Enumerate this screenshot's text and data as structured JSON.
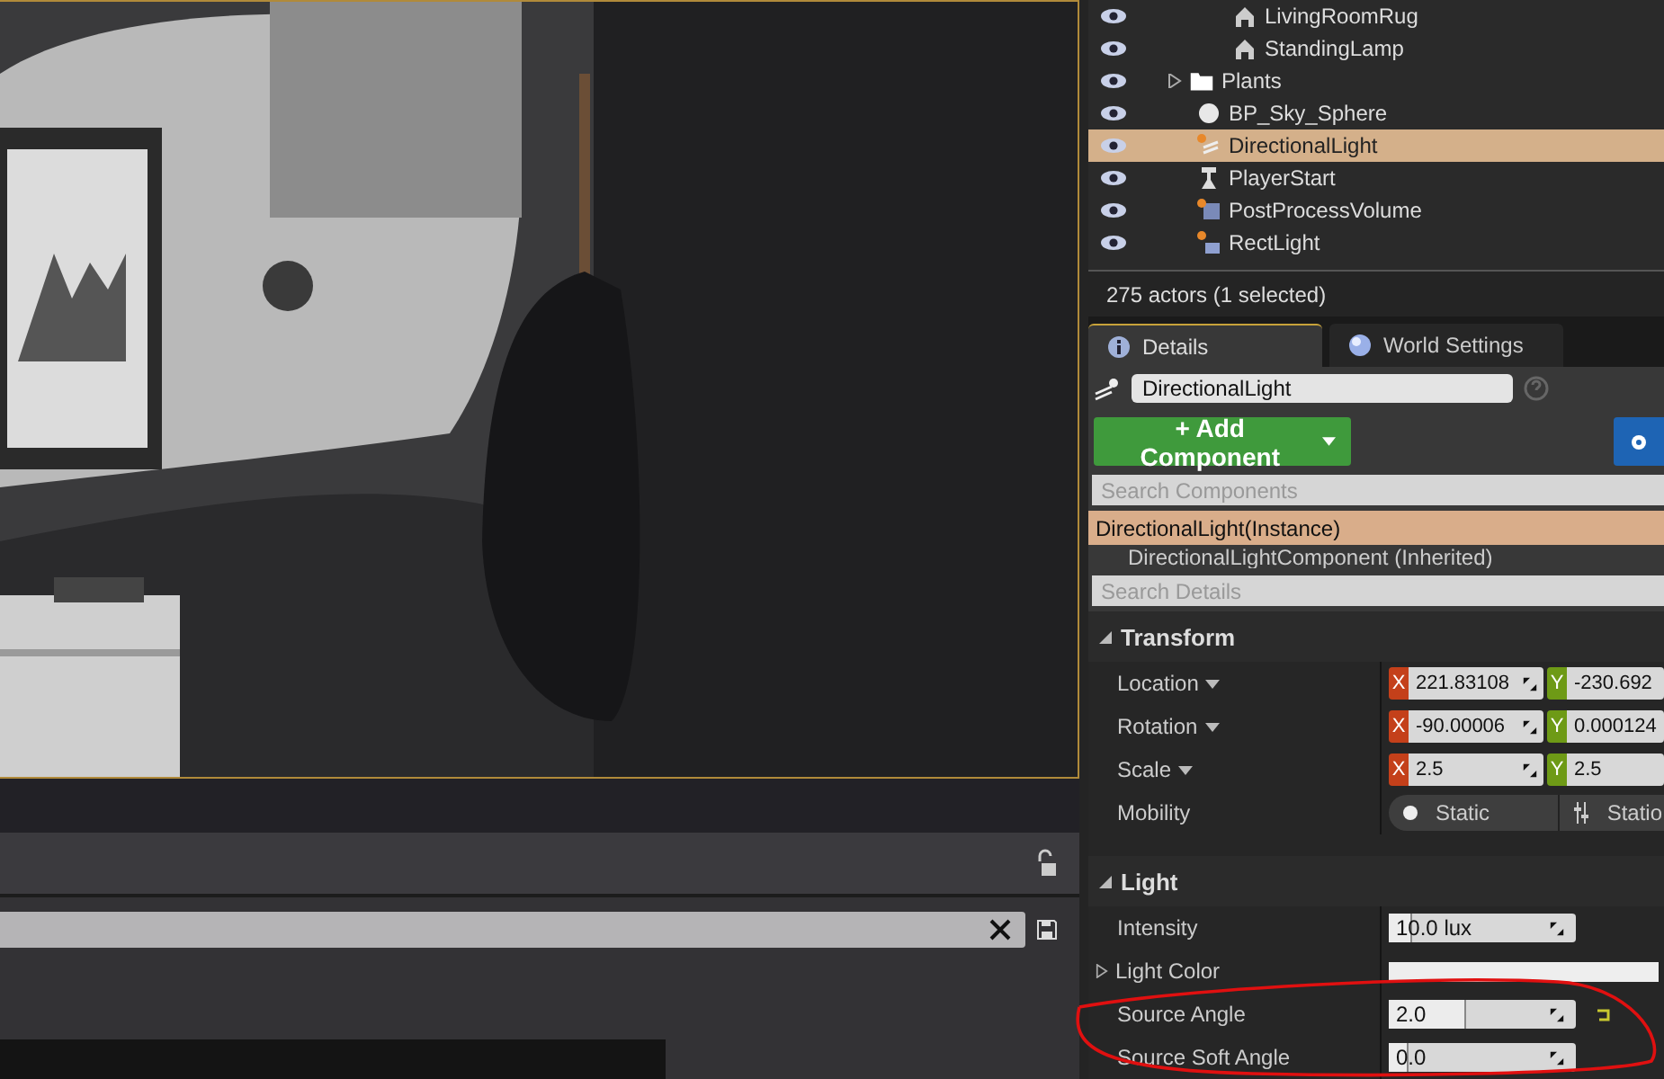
{
  "outliner": {
    "continued_children": [
      {
        "label": "LivingRoomRug",
        "kind": "mesh"
      },
      {
        "label": "StandingLamp",
        "kind": "mesh"
      }
    ],
    "items": [
      {
        "label": "Plants",
        "kind": "folder",
        "expanded": false,
        "selected": false
      },
      {
        "label": "BP_Sky_Sphere",
        "kind": "sphere",
        "selected": false
      },
      {
        "label": "DirectionalLight",
        "kind": "sun",
        "selected": true
      },
      {
        "label": "PlayerStart",
        "kind": "player",
        "selected": false
      },
      {
        "label": "PostProcessVolume",
        "kind": "volume",
        "selected": false
      },
      {
        "label": "RectLight",
        "kind": "rectlight",
        "selected": false
      }
    ],
    "status": "275 actors (1 selected)"
  },
  "details": {
    "tabs": [
      {
        "label": "Details",
        "kind": "info",
        "selected": true
      },
      {
        "label": "World Settings",
        "kind": "globe",
        "selected": false
      }
    ],
    "name_value": "DirectionalLight",
    "add_button": "+ Add Component",
    "components_placeholder": "Search Components",
    "components": [
      {
        "label": "DirectionalLight(Instance)",
        "selected": true
      },
      {
        "label": "DirectionalLightComponent (Inherited)",
        "selected": false
      }
    ],
    "details_placeholder": "Search Details",
    "sections": [
      {
        "title": "Transform",
        "rows": [
          {
            "kind": "vector",
            "label": "Location",
            "axes": [
              {
                "axis": "X",
                "value": "221.83108",
                "color": "#c4401a"
              },
              {
                "axis": "Y",
                "value": "-230.692",
                "color": "#6e9a16"
              }
            ]
          },
          {
            "kind": "vector",
            "label": "Rotation",
            "axes": [
              {
                "axis": "X",
                "value": "-90.00006",
                "color": "#c4401a"
              },
              {
                "axis": "Y",
                "value": "0.000124",
                "color": "#6e9a16"
              }
            ]
          },
          {
            "kind": "vector",
            "label": "Scale",
            "axes": [
              {
                "axis": "X",
                "value": "2.5",
                "color": "#c4401a"
              },
              {
                "axis": "Y",
                "value": "2.5",
                "color": "#6e9a16"
              }
            ]
          },
          {
            "kind": "mobility",
            "label": "Mobility",
            "options": [
              "Static",
              "Statio"
            ]
          }
        ]
      },
      {
        "title": "Light",
        "rows": [
          {
            "kind": "slider",
            "label": "Intensity",
            "value": "10.0 lux",
            "level": 0.12
          },
          {
            "kind": "color",
            "label": "Light Color"
          },
          {
            "kind": "slider",
            "label": "Source Angle",
            "value": "2.0",
            "level": 0.4,
            "reset": true
          },
          {
            "kind": "slider",
            "label": "Source Soft Angle",
            "value": "0.0",
            "level": 0.1
          }
        ]
      }
    ]
  }
}
